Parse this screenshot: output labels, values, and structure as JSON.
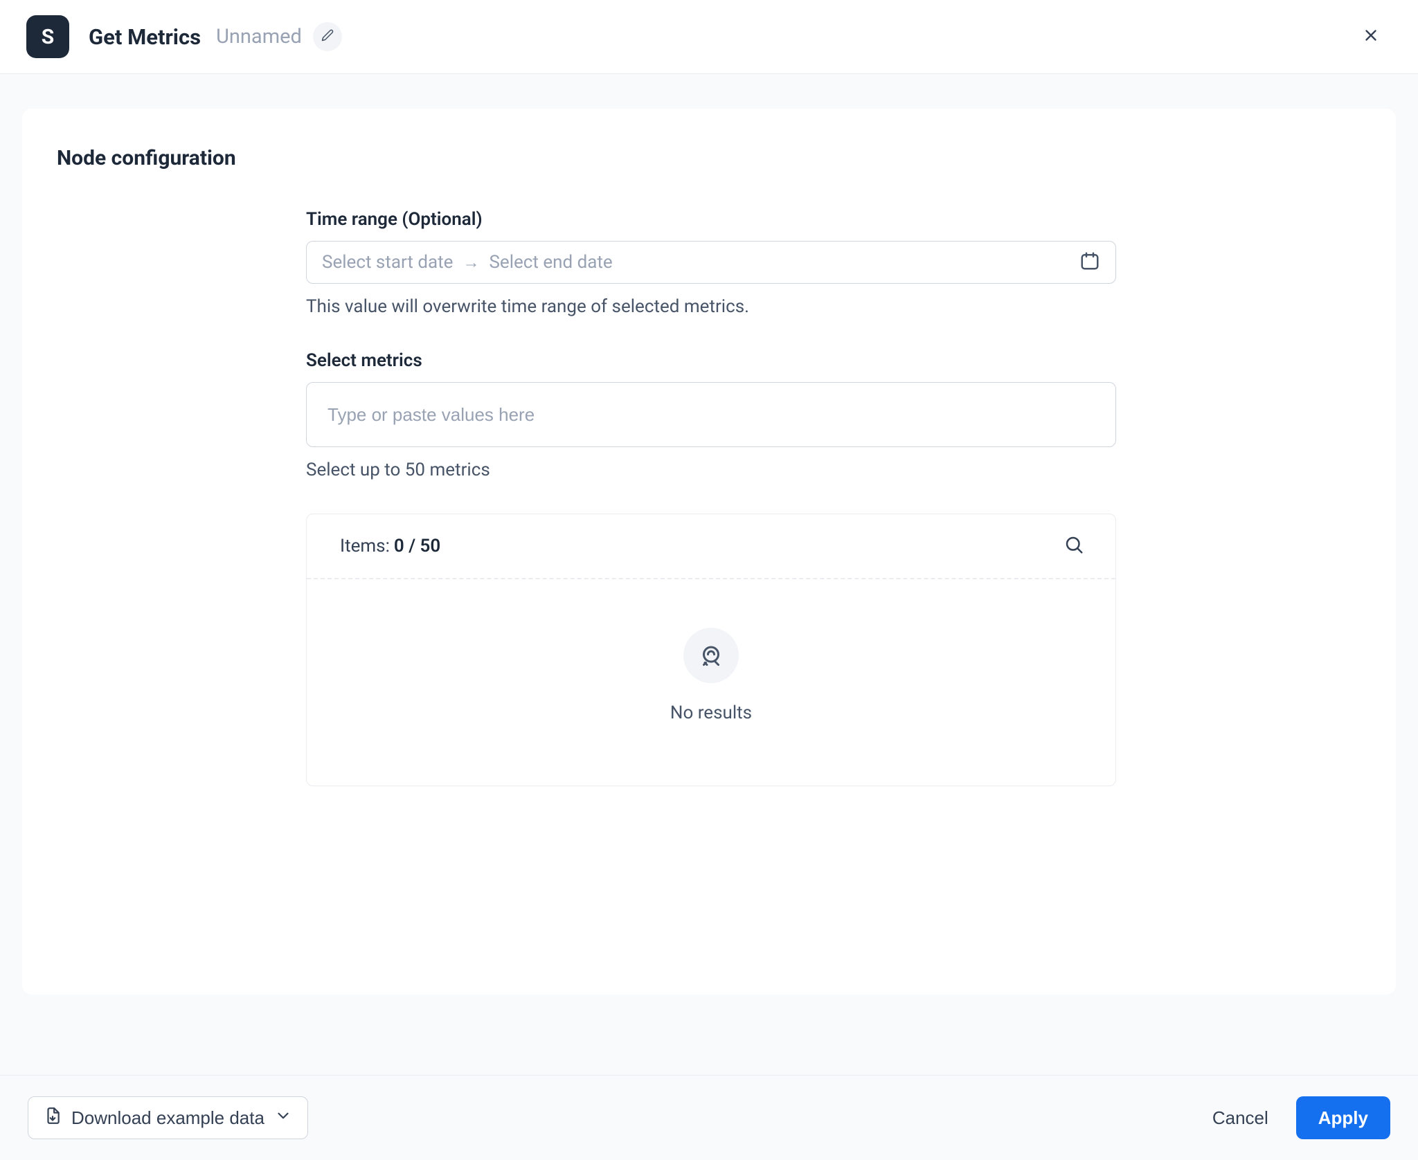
{
  "header": {
    "app_letter": "S",
    "title": "Get Metrics",
    "subtitle": "Unnamed"
  },
  "config": {
    "section_heading": "Node configuration",
    "time_range": {
      "label": "Time range (Optional)",
      "start_placeholder": "Select start date",
      "end_placeholder": "Select end date",
      "help": "This value will overwrite time range of selected metrics."
    },
    "metrics": {
      "label": "Select metrics",
      "placeholder": "Type or paste values here",
      "help": "Select up to 50 metrics"
    },
    "results": {
      "items_label": "Items:",
      "items_count": "0 / 50",
      "no_results": "No results"
    }
  },
  "footer": {
    "download_label": "Download example data",
    "cancel_label": "Cancel",
    "apply_label": "Apply"
  }
}
